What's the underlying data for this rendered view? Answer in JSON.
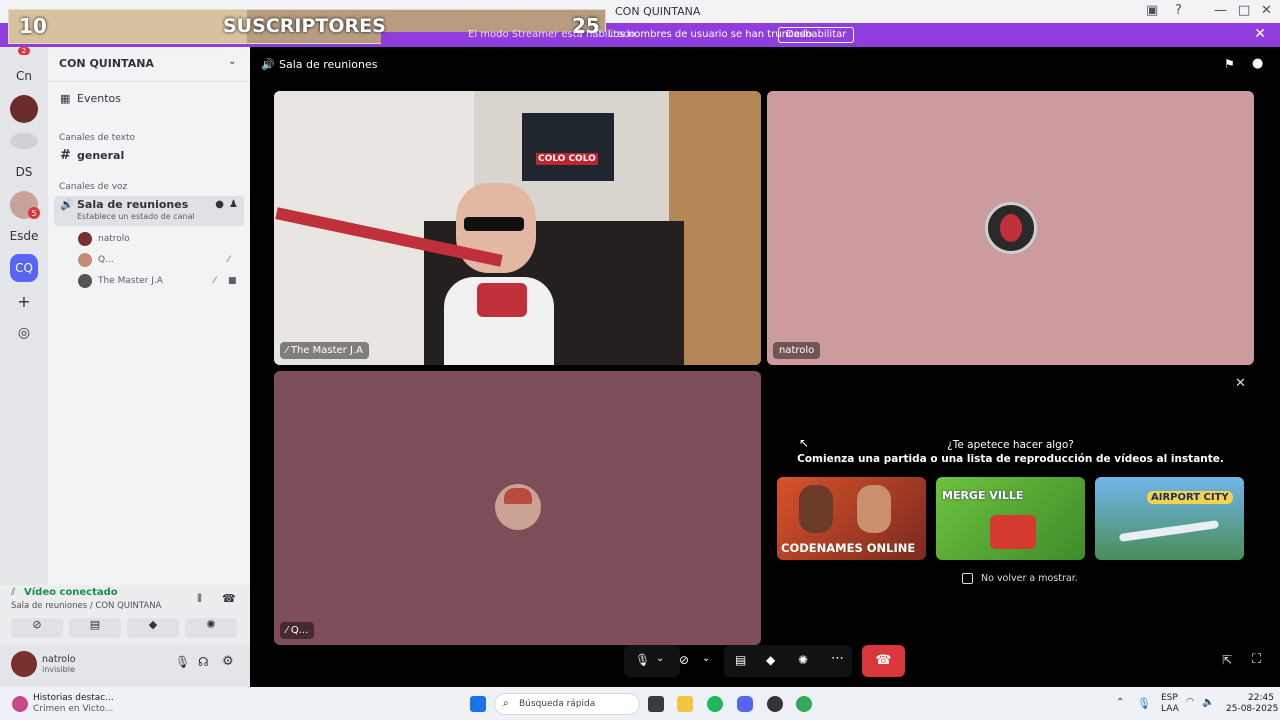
{
  "window": {
    "title": "CON QUINTANA"
  },
  "overlay": {
    "left_number": "10",
    "label": "SUSCRIPTORES",
    "right_number": "25",
    "progress": 0.4
  },
  "banner": {
    "message_part1": "El modo Streamer está habilitado.",
    "message_part2": "Los nombres de usuario se han truncado.",
    "button": "Deshabilitar"
  },
  "rail": {
    "servers": [
      "Cn",
      "DS",
      "Esde",
      "CQ"
    ],
    "badge_top": "2",
    "badge_mid": "5"
  },
  "sidebar": {
    "server_name": "CON QUINTANA",
    "events_label": "Eventos",
    "text_category": "Canales de texto",
    "text_channel": "general",
    "voice_category": "Canales de voz",
    "voice_channel": "Sala de reuniones",
    "voice_status": "Establece un estado de canal",
    "members": [
      "natrolo",
      "Q...",
      "The Master J.A"
    ]
  },
  "voice": {
    "status": "Vídeo conectado",
    "location": "Sala de reuniones / CON QUINTANA"
  },
  "user": {
    "name": "natrolo",
    "status": "invisible"
  },
  "call": {
    "header": "Sala de reuniones",
    "tiles": [
      "The Master J.A",
      "natrolo",
      "Q..."
    ],
    "activity_title": "¿Te apetece hacer algo?",
    "activity_subtitle": "Comienza una partida o una lista de reproducción de vídeos al instante.",
    "games": [
      "CODENAMES ONLINE",
      "MERGE VILLE",
      "AIRPORT CITY"
    ],
    "dont_show": "No volver a mostrar.",
    "banner_text": "COLO COLO"
  },
  "taskbar": {
    "news_title": "Historias destac...",
    "news_subtitle": "Crimen en Victo...",
    "search_placeholder": "Búsqueda rápida",
    "lang": "ESP",
    "region": "LAA",
    "time": "22:45",
    "date": "25-08-2025"
  },
  "colors": {
    "accent": "#8f3ddc",
    "end_call": "#da373c",
    "voice_green": "#23a55a"
  }
}
